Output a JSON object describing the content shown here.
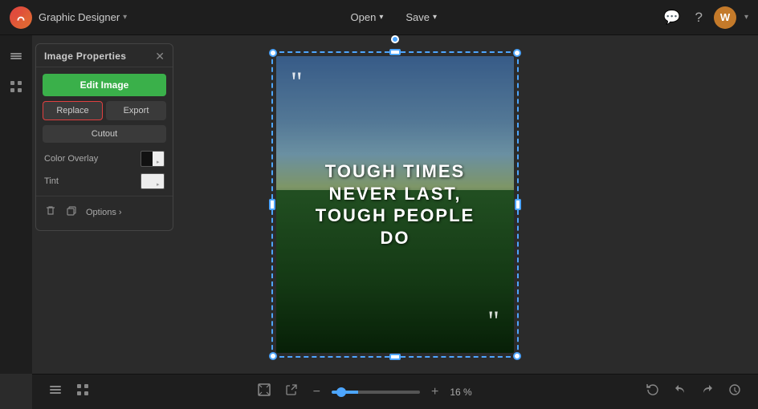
{
  "app": {
    "brand": "Graphic Designer",
    "brand_chevron": "▾"
  },
  "nav": {
    "open_label": "Open",
    "save_label": "Save",
    "open_chevron": "▾",
    "save_chevron": "▾"
  },
  "panel": {
    "title": "Image Properties",
    "edit_image_label": "Edit Image",
    "replace_label": "Replace",
    "export_label": "Export",
    "cutout_label": "Cutout",
    "color_overlay_label": "Color Overlay",
    "tint_label": "Tint",
    "options_label": "Options",
    "options_chevron": "›"
  },
  "canvas": {
    "quote_open": "““",
    "quote_close": "””",
    "card_text": "Tough Times\nNever Last,\nTough People\nDo"
  },
  "bottom_toolbar": {
    "zoom_percent": "16 %",
    "zoom_value": 16
  },
  "icons": {
    "layers": "⊞",
    "grid": "▦",
    "comment": "💬",
    "help": "?",
    "fit_screen": "⛶",
    "external": "⤢",
    "zoom_out": "−",
    "zoom_in": "+",
    "undo": "↩",
    "redo": "↪",
    "history": "🕐",
    "refresh": "↻",
    "trash": "🗑",
    "duplicate": "❐",
    "rotate": "↺"
  }
}
